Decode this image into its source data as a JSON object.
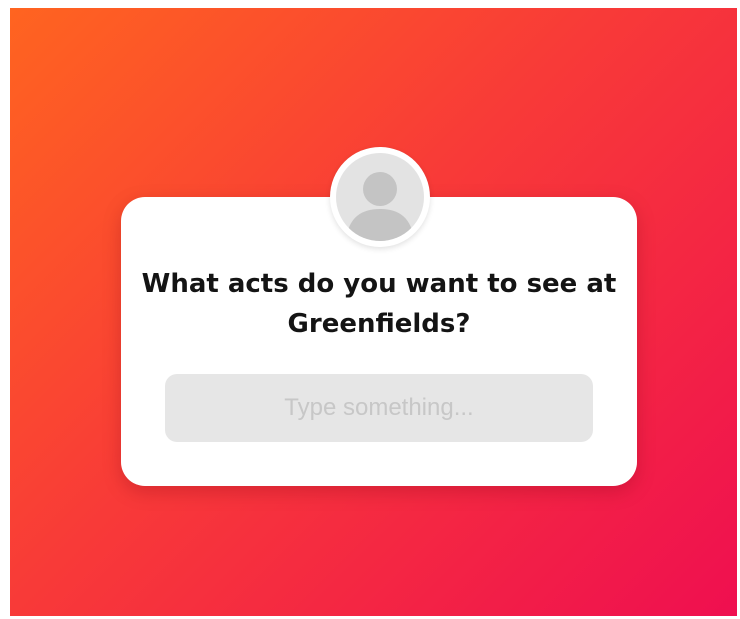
{
  "question_sticker": {
    "question": "What acts do you want to see at Greenfields?",
    "input_placeholder": "Type something..."
  },
  "avatar": {
    "icon": "user-silhouette-icon"
  },
  "colors": {
    "gradient_start": "#ff6420",
    "gradient_end": "#ef0f50",
    "card": "#ffffff",
    "input_bg": "#e6e6e6",
    "placeholder": "#c7c7c7"
  }
}
